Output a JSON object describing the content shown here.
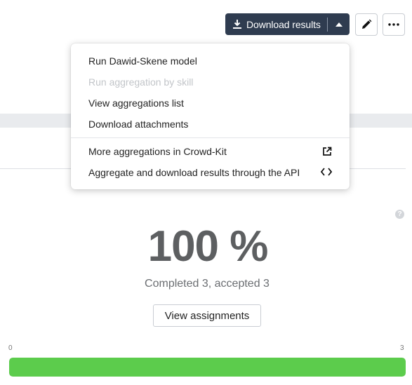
{
  "toolbar": {
    "download_label": "Download results",
    "download_icon": "download-icon",
    "caret_icon": "caret-up-icon",
    "edit_icon": "pencil-icon",
    "more_icon": "more-horizontal-icon"
  },
  "dropdown": {
    "items": [
      {
        "label": "Run Dawid-Skene model",
        "disabled": false
      },
      {
        "label": "Run aggregation by skill",
        "disabled": true
      },
      {
        "label": "View aggregations list",
        "disabled": false
      },
      {
        "label": "Download attachments",
        "disabled": false
      },
      {
        "label": "More aggregations in Crowd-Kit",
        "disabled": false,
        "icon": "external-link-icon"
      },
      {
        "label": "Aggregate and download results through the API",
        "disabled": false,
        "icon": "code-brackets-icon"
      }
    ]
  },
  "stats": {
    "percent_text": "100 %",
    "completed_text": "Completed 3, accepted 3",
    "view_button": "View assignments",
    "help_icon": "question-icon",
    "help_glyph": "?"
  },
  "progress": {
    "min_label": "0",
    "max_label": "3",
    "fraction": 1.0
  },
  "colors": {
    "primary_button": "#2f3c50",
    "progress_fill": "#5ccc4c",
    "percent_text": "#5d5f61",
    "disabled_text": "#c2c5c9"
  }
}
